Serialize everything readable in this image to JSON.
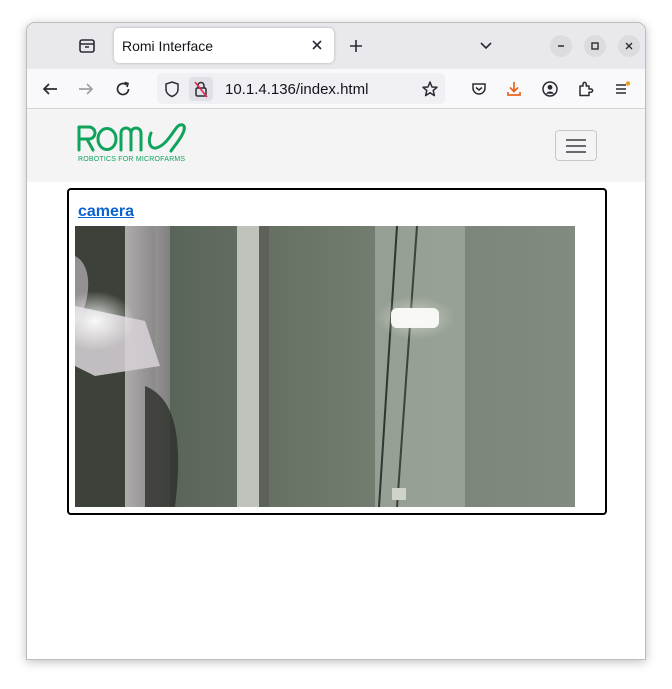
{
  "browser": {
    "tab": {
      "title": "Romi Interface"
    },
    "url": "10.1.4.136/index.html"
  },
  "header": {
    "logo": {
      "wordmark": "ROMI",
      "tagline": "ROBOTICS FOR MICROFARMS",
      "color": "#0fa35b"
    }
  },
  "main": {
    "card": {
      "link_label": "camera"
    }
  },
  "colors": {
    "link": "#0b63ce",
    "download_accent": "#e8631f"
  }
}
